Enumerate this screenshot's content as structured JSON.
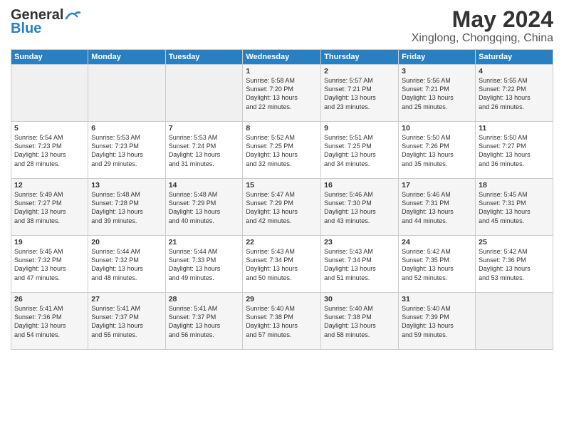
{
  "logo": {
    "line1": "General",
    "line2": "Blue"
  },
  "header": {
    "month": "May 2024",
    "location": "Xinglong, Chongqing, China"
  },
  "weekdays": [
    "Sunday",
    "Monday",
    "Tuesday",
    "Wednesday",
    "Thursday",
    "Friday",
    "Saturday"
  ],
  "weeks": [
    [
      {
        "day": "",
        "text": ""
      },
      {
        "day": "",
        "text": ""
      },
      {
        "day": "",
        "text": ""
      },
      {
        "day": "1",
        "text": "Sunrise: 5:58 AM\nSunset: 7:20 PM\nDaylight: 13 hours\nand 22 minutes."
      },
      {
        "day": "2",
        "text": "Sunrise: 5:57 AM\nSunset: 7:21 PM\nDaylight: 13 hours\nand 23 minutes."
      },
      {
        "day": "3",
        "text": "Sunrise: 5:56 AM\nSunset: 7:21 PM\nDaylight: 13 hours\nand 25 minutes."
      },
      {
        "day": "4",
        "text": "Sunrise: 5:55 AM\nSunset: 7:22 PM\nDaylight: 13 hours\nand 26 minutes."
      }
    ],
    [
      {
        "day": "5",
        "text": "Sunrise: 5:54 AM\nSunset: 7:23 PM\nDaylight: 13 hours\nand 28 minutes."
      },
      {
        "day": "6",
        "text": "Sunrise: 5:53 AM\nSunset: 7:23 PM\nDaylight: 13 hours\nand 29 minutes."
      },
      {
        "day": "7",
        "text": "Sunrise: 5:53 AM\nSunset: 7:24 PM\nDaylight: 13 hours\nand 31 minutes."
      },
      {
        "day": "8",
        "text": "Sunrise: 5:52 AM\nSunset: 7:25 PM\nDaylight: 13 hours\nand 32 minutes."
      },
      {
        "day": "9",
        "text": "Sunrise: 5:51 AM\nSunset: 7:25 PM\nDaylight: 13 hours\nand 34 minutes."
      },
      {
        "day": "10",
        "text": "Sunrise: 5:50 AM\nSunset: 7:26 PM\nDaylight: 13 hours\nand 35 minutes."
      },
      {
        "day": "11",
        "text": "Sunrise: 5:50 AM\nSunset: 7:27 PM\nDaylight: 13 hours\nand 36 minutes."
      }
    ],
    [
      {
        "day": "12",
        "text": "Sunrise: 5:49 AM\nSunset: 7:27 PM\nDaylight: 13 hours\nand 38 minutes."
      },
      {
        "day": "13",
        "text": "Sunrise: 5:48 AM\nSunset: 7:28 PM\nDaylight: 13 hours\nand 39 minutes."
      },
      {
        "day": "14",
        "text": "Sunrise: 5:48 AM\nSunset: 7:29 PM\nDaylight: 13 hours\nand 40 minutes."
      },
      {
        "day": "15",
        "text": "Sunrise: 5:47 AM\nSunset: 7:29 PM\nDaylight: 13 hours\nand 42 minutes."
      },
      {
        "day": "16",
        "text": "Sunrise: 5:46 AM\nSunset: 7:30 PM\nDaylight: 13 hours\nand 43 minutes."
      },
      {
        "day": "17",
        "text": "Sunrise: 5:46 AM\nSunset: 7:31 PM\nDaylight: 13 hours\nand 44 minutes."
      },
      {
        "day": "18",
        "text": "Sunrise: 5:45 AM\nSunset: 7:31 PM\nDaylight: 13 hours\nand 45 minutes."
      }
    ],
    [
      {
        "day": "19",
        "text": "Sunrise: 5:45 AM\nSunset: 7:32 PM\nDaylight: 13 hours\nand 47 minutes."
      },
      {
        "day": "20",
        "text": "Sunrise: 5:44 AM\nSunset: 7:32 PM\nDaylight: 13 hours\nand 48 minutes."
      },
      {
        "day": "21",
        "text": "Sunrise: 5:44 AM\nSunset: 7:33 PM\nDaylight: 13 hours\nand 49 minutes."
      },
      {
        "day": "22",
        "text": "Sunrise: 5:43 AM\nSunset: 7:34 PM\nDaylight: 13 hours\nand 50 minutes."
      },
      {
        "day": "23",
        "text": "Sunrise: 5:43 AM\nSunset: 7:34 PM\nDaylight: 13 hours\nand 51 minutes."
      },
      {
        "day": "24",
        "text": "Sunrise: 5:42 AM\nSunset: 7:35 PM\nDaylight: 13 hours\nand 52 minutes."
      },
      {
        "day": "25",
        "text": "Sunrise: 5:42 AM\nSunset: 7:36 PM\nDaylight: 13 hours\nand 53 minutes."
      }
    ],
    [
      {
        "day": "26",
        "text": "Sunrise: 5:41 AM\nSunset: 7:36 PM\nDaylight: 13 hours\nand 54 minutes."
      },
      {
        "day": "27",
        "text": "Sunrise: 5:41 AM\nSunset: 7:37 PM\nDaylight: 13 hours\nand 55 minutes."
      },
      {
        "day": "28",
        "text": "Sunrise: 5:41 AM\nSunset: 7:37 PM\nDaylight: 13 hours\nand 56 minutes."
      },
      {
        "day": "29",
        "text": "Sunrise: 5:40 AM\nSunset: 7:38 PM\nDaylight: 13 hours\nand 57 minutes."
      },
      {
        "day": "30",
        "text": "Sunrise: 5:40 AM\nSunset: 7:38 PM\nDaylight: 13 hours\nand 58 minutes."
      },
      {
        "day": "31",
        "text": "Sunrise: 5:40 AM\nSunset: 7:39 PM\nDaylight: 13 hours\nand 59 minutes."
      },
      {
        "day": "",
        "text": ""
      }
    ]
  ]
}
